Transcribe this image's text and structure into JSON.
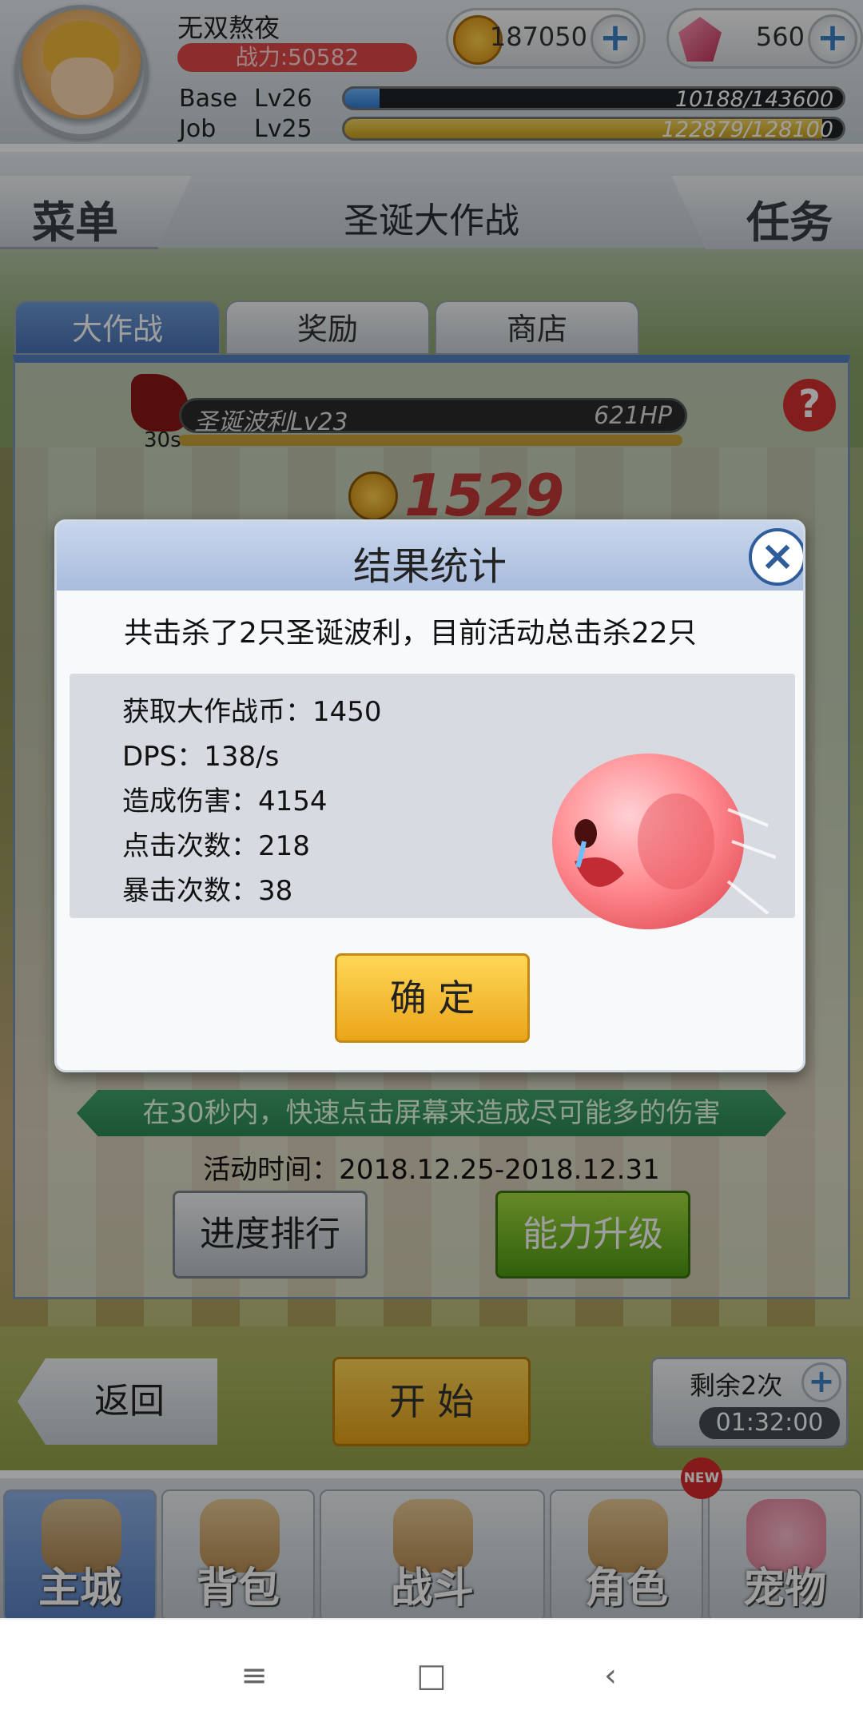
{
  "player": {
    "name": "无双熬夜",
    "power": "战力:50582"
  },
  "currency": {
    "coins": "187050",
    "gems": "560"
  },
  "levels": {
    "base": {
      "label": "Base",
      "level": "Lv26",
      "exp": "10188/143600",
      "progress": 0.071
    },
    "job": {
      "label": "Job",
      "level": "Lv25",
      "exp": "122879/128100",
      "progress": 0.959
    }
  },
  "header": {
    "menu": "菜单",
    "title": "圣诞大作战",
    "task": "任务"
  },
  "tabs": [
    {
      "label": "大作战"
    },
    {
      "label": "奖励"
    },
    {
      "label": "商店"
    }
  ],
  "boss": {
    "name": "圣诞波利Lv23",
    "hp": "621HP",
    "timer": "30s"
  },
  "event": {
    "total_coins": "1529",
    "banner": "在30秒内，快速点击屏幕来造成尽可能多的伤害",
    "time": "活动时间：2018.12.25-2018.12.31",
    "rank_button": "进度排行",
    "upgrade_button": "能力升级"
  },
  "bottom": {
    "back": "返回",
    "start": "开 始",
    "remaining": "剩余2次",
    "countdown": "01:32:00"
  },
  "nav": [
    {
      "label": "主城"
    },
    {
      "label": "背包"
    },
    {
      "label": "战斗"
    },
    {
      "label": "角色"
    },
    {
      "label": "宠物"
    }
  ],
  "badge": "NEW",
  "modal": {
    "title": "结果统计",
    "summary": "共击杀了2只圣诞波利，目前活动总击杀22只",
    "stats": [
      "获取大作战币：1450",
      "DPS：138/s",
      "造成伤害：4154",
      "点击次数：218",
      "暴击次数：38"
    ],
    "confirm": "确 定"
  },
  "colors": {
    "accent_blue": "#4873b5",
    "confirm_yellow": "#ffd757",
    "upgrade_green": "#4f9b13",
    "power_red": "#e04a4a"
  }
}
